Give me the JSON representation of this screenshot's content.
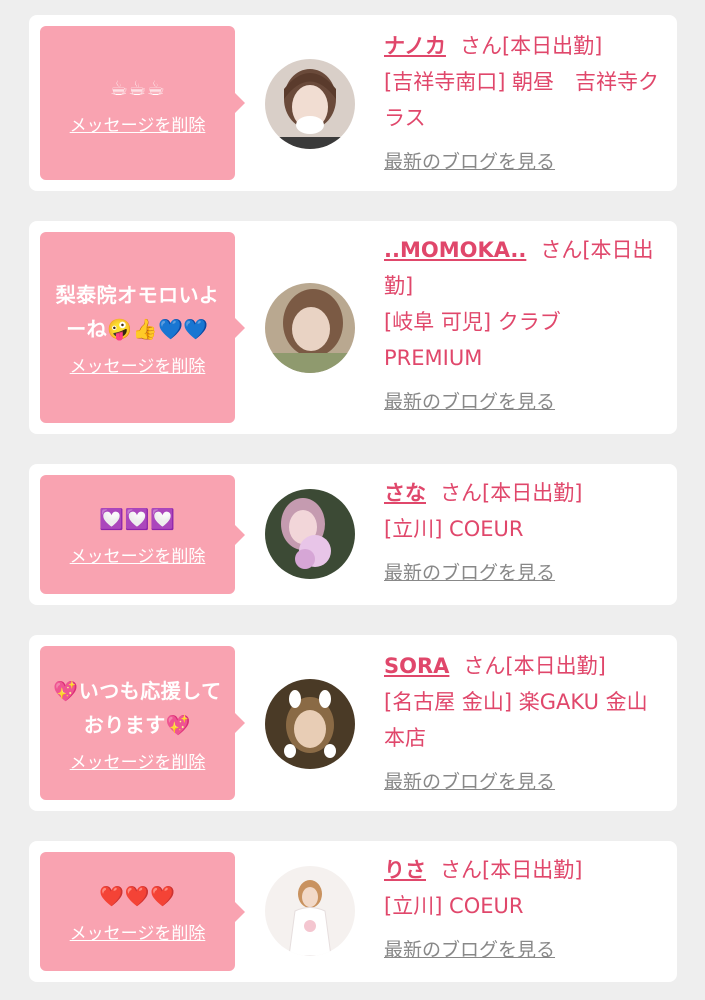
{
  "delete_label": "メッセージを削除",
  "blog_label": "最新のブログを見る",
  "cards": [
    {
      "message": "☕☕☕",
      "name": "ナノカ",
      "status": "さん[本日出勤]",
      "shop": "[吉祥寺南口] 朝昼　吉祥寺クラス"
    },
    {
      "message": "梨泰院オモロいよーね🤪👍💙💙",
      "name": "..MOMOKA..",
      "status": "さん[本日出勤]",
      "shop": "[岐阜 可児] クラブ PREMIUM"
    },
    {
      "message": "💟💟💟",
      "name": "さな",
      "status": "さん[本日出勤]",
      "shop": "[立川] COEUR"
    },
    {
      "message": "💖いつも応援しております💖",
      "name": "SORA",
      "status": "さん[本日出勤]",
      "shop": "[名古屋 金山] 楽GAKU 金山本店"
    },
    {
      "message": "❤️❤️❤️",
      "name": "りさ",
      "status": "さん[本日出勤]",
      "shop": "[立川] COEUR"
    }
  ],
  "colors": {
    "bubble": "#f9a3b1",
    "accent": "#e0476b",
    "link_gray": "#888888",
    "background": "#eeeeee"
  }
}
